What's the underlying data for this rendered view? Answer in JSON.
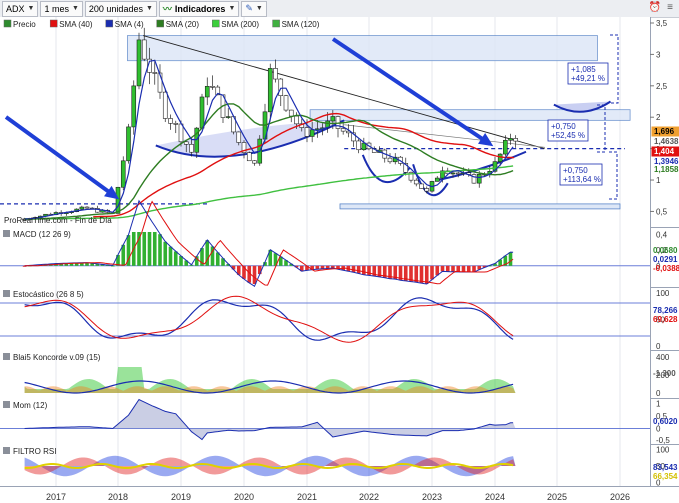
{
  "toolbar": {
    "symbol": "ADX",
    "period": "1 mes",
    "units": "200 unidades",
    "indicators": "Indicadores"
  },
  "price_legend": [
    {
      "label": "Precio",
      "color": "#2e8b2e"
    },
    {
      "label": "SMA (40)",
      "color": "#e01010"
    },
    {
      "label": "SMA (4)",
      "color": "#1a2db0"
    },
    {
      "label": "SMA (20)",
      "color": "#2e7d22"
    },
    {
      "label": "SMA (200)",
      "color": "#3ccf3c"
    },
    {
      "label": "SMA (120)",
      "color": "#40b040"
    }
  ],
  "source_label": "ProRealTime.com - Fin de Día",
  "panels": {
    "macd": "MACD (12 26 9)",
    "stoch": "Estocástico (26 8 5)",
    "koncorde": "Blai5 Koncorde v.09 (15)",
    "mom": "Mom (12)",
    "rsi": "FILTRO RSI"
  },
  "annotations": {
    "box_top": [
      "+1,085",
      "+49,21 %"
    ],
    "box_mid": [
      "+0,750",
      "+52,45 %"
    ],
    "box_low": [
      "+0,750",
      "+113,64 %"
    ]
  },
  "price_axis_ticks": [
    "3,5",
    "3",
    "2,5",
    "2",
    "1,5",
    "1",
    "0,5"
  ],
  "price_value_labels": [
    {
      "text": "1,696",
      "bg": "#f0a030",
      "color": "#000000"
    },
    {
      "text": "1,4638",
      "bg": "#ffffff",
      "color": "#555555"
    },
    {
      "text": "1,404",
      "bg": "#e01010",
      "color": "#ffffff"
    },
    {
      "text": "1,3946",
      "bg": "#ffffff",
      "color": "#1a2db0"
    },
    {
      "text": "1,1858",
      "bg": "#ffffff",
      "color": "#2e7d22"
    }
  ],
  "panel_axes": {
    "macd": {
      "ticks": [
        "0,4",
        "0,2",
        "0"
      ],
      "values": [
        {
          "text": "0,0680",
          "color": "#2e8b2e"
        },
        {
          "text": "0,0291",
          "color": "#1a2db0"
        },
        {
          "text": "-0,0388",
          "color": "#e01010"
        }
      ]
    },
    "stoch": {
      "ticks": [
        "100",
        "50",
        "0"
      ],
      "values": [
        {
          "text": "78,266",
          "color": "#1a2db0"
        },
        {
          "text": "69,628",
          "color": "#e01010"
        }
      ]
    },
    "koncorde": {
      "ticks": [
        "400",
        "200",
        "0"
      ],
      "values": [
        {
          "text": "-1,300",
          "color": "#555555"
        }
      ]
    },
    "mom": {
      "ticks": [
        "1",
        "0,5",
        "0",
        "-0,5"
      ],
      "values": [
        {
          "text": "0,6020",
          "color": "#1a2db0"
        }
      ]
    },
    "rsi": {
      "ticks": [
        "100",
        "50",
        "0"
      ],
      "values": [
        {
          "text": "83,543",
          "color": "#1a2db0"
        },
        {
          "text": "66,354",
          "color": "#d4c000"
        }
      ]
    }
  },
  "chart_data": {
    "type": "candlestick",
    "symbol": "ADX",
    "timeframe": "1 mes",
    "x_tick_labels": [
      "2017",
      "2018",
      "2019",
      "2020",
      "2021",
      "2022",
      "2023",
      "2024",
      "2025",
      "2026"
    ],
    "ylim": [
      0.3,
      3.5
    ],
    "series_price_approx": [
      {
        "date": "2016-07",
        "close": 0.38
      },
      {
        "date": "2017-01",
        "close": 0.48
      },
      {
        "date": "2017-07",
        "close": 0.55
      },
      {
        "date": "2017-12",
        "close": 0.46
      },
      {
        "date": "2018-03",
        "close": 1.75
      },
      {
        "date": "2018-05",
        "close": 3.25
      },
      {
        "date": "2018-10",
        "close": 2.1
      },
      {
        "date": "2019-03",
        "close": 1.45
      },
      {
        "date": "2019-06",
        "close": 2.6
      },
      {
        "date": "2019-12",
        "close": 1.6
      },
      {
        "date": "2020-03",
        "close": 1.25
      },
      {
        "date": "2020-06",
        "close": 2.7
      },
      {
        "date": "2020-12",
        "close": 1.75
      },
      {
        "date": "2021-06",
        "close": 1.9
      },
      {
        "date": "2021-12",
        "close": 1.5
      },
      {
        "date": "2022-06",
        "close": 1.3
      },
      {
        "date": "2022-12",
        "close": 0.8
      },
      {
        "date": "2023-03",
        "close": 1.2
      },
      {
        "date": "2023-09",
        "close": 1.0
      },
      {
        "date": "2024-01",
        "close": 1.25
      },
      {
        "date": "2024-04",
        "close": 1.696
      }
    ],
    "levels": {
      "resistance_top": 2.9,
      "resistance_mid": 2.05,
      "support": 1.5,
      "support_low": 0.62
    },
    "last": {
      "price": 1.696,
      "sma4": 1.404
    }
  }
}
